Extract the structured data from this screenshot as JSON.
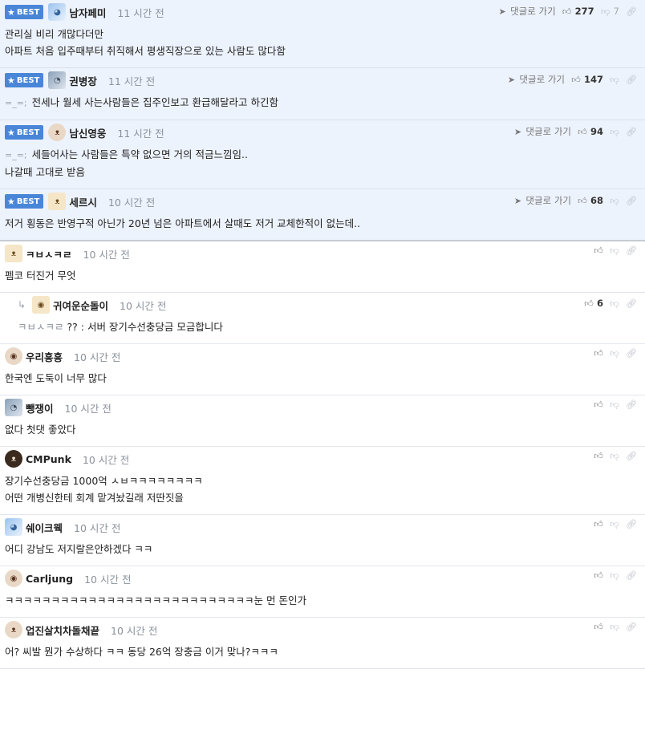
{
  "labels": {
    "best": "BEST",
    "reply": "댓글로 가기"
  },
  "icons": {
    "best": "star-icon",
    "reply": "send-arrow-icon",
    "like": "thumbs-up-icon",
    "dislike": "thumbs-down-icon",
    "link": "link-icon",
    "reply_indent": "reply-arrow-icon"
  },
  "colors": {
    "best_badge": "#4a86d8",
    "best_bg": "#edf3fc"
  },
  "comments": [
    {
      "best": true,
      "nick": "남자페미",
      "time": "11 시간 전",
      "up": "277",
      "down": "7",
      "lines": [
        "관리실 비리 개많다더만",
        "아파트 처음 입주때부터 취직해서 평생직장으로 있는 사람도 많다함"
      ]
    },
    {
      "best": true,
      "nick": "권병장",
      "time": "11 시간 전",
      "up": "147",
      "down": "",
      "emo": "=_=;",
      "lines": [
        "전세나 월세 사는사람들은 집주인보고 환급해달라고 하긴함"
      ]
    },
    {
      "best": true,
      "nick": "남신영웅",
      "time": "11 시간 전",
      "up": "94",
      "down": "",
      "emo": "=_=;",
      "lines": [
        "세들어사는 사람들은 특약 없으면 거의 적금느낌임..",
        "나갈때 고대로 받음"
      ]
    },
    {
      "best": true,
      "nick": "세르시",
      "time": "10 시간 전",
      "up": "68",
      "down": "",
      "lines": [
        "저거 횡동은 반영구적 아닌가 20년 넘은 아파트에서 살때도 저거 교체한적이 없는데.."
      ]
    },
    {
      "nick": "ㅋㅂㅅㅋㄹ",
      "time": "10 시간 전",
      "up": "",
      "lines": [
        "펨코 터진거 무엇"
      ]
    },
    {
      "reply": true,
      "nick": "귀여운순돌이",
      "time": "10 시간 전",
      "up": "6",
      "mention": "ㅋㅂㅅㅋㄹ",
      "lines": [
        "?? : 서버 장기수선충당금 모금합니다"
      ]
    },
    {
      "nick": "우리흥흥",
      "time": "10 시간 전",
      "up": "",
      "lines": [
        "한국엔 도둑이 너무 많다"
      ]
    },
    {
      "nick": "뺑쟁이",
      "time": "10 시간 전",
      "up": "",
      "lines": [
        "없다 첫댓 좋았다"
      ]
    },
    {
      "nick": "CMPunk",
      "time": "10 시간 전",
      "up": "",
      "lines": [
        "장기수선충당금 1000억 ㅅㅂㅋㅋㅋㅋㅋㅋㅋㅋ",
        "어떤 개병신한테 회계 맡겨놨길래 저딴짓을"
      ]
    },
    {
      "nick": "쉐이크웩",
      "time": "10 시간 전",
      "up": "",
      "lines": [
        "어디 강남도 저지랄은안하겠다 ㅋㅋ"
      ]
    },
    {
      "nick": "Carljung",
      "time": "10 시간 전",
      "up": "",
      "lines": [
        "ㅋㅋㅋㅋㅋㅋㅋㅋㅋㅋㅋㅋㅋㅋㅋㅋㅋㅋㅋㅋㅋㅋㅋㅋㅋㅋㅋ눈 먼 돈인가"
      ]
    },
    {
      "nick": "업진살치차돌채끝",
      "time": "10 시간 전",
      "up": "",
      "lines": [
        "어? 씨발 뭔가 수상하다 ㅋㅋ 동당 26억 장충금 이거 맞나?ㅋㅋㅋ"
      ]
    }
  ]
}
